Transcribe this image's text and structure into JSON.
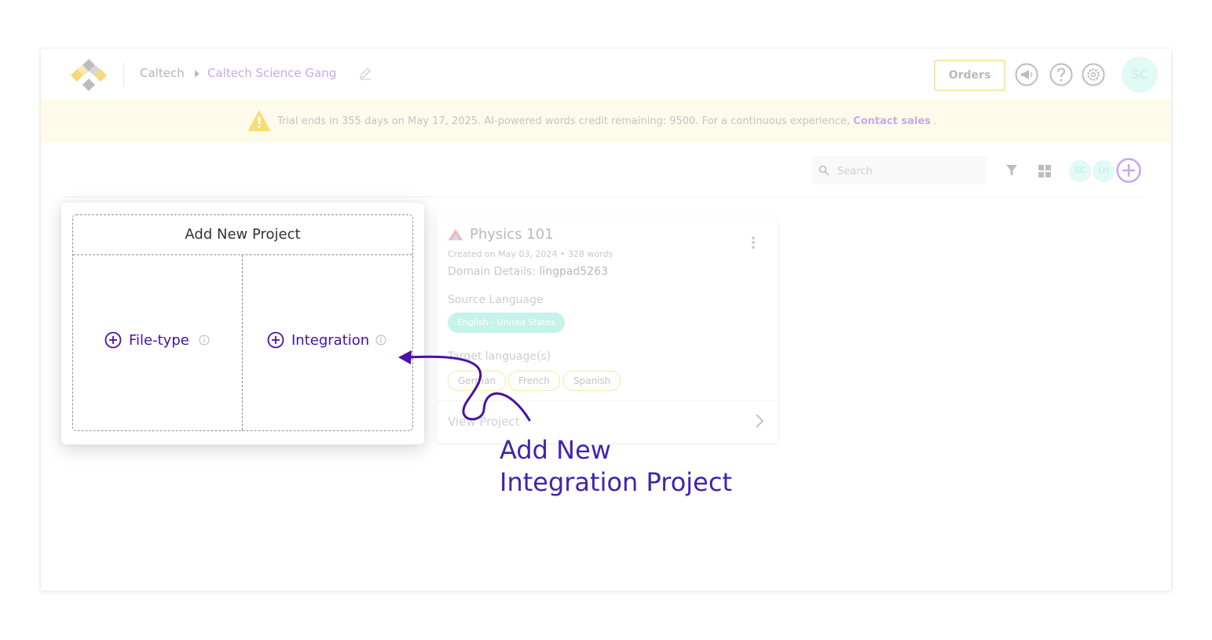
{
  "header": {
    "org": "Caltech",
    "team": "Caltech Science Gang",
    "orders_label": "Orders",
    "avatar_initials": "SC"
  },
  "banner": {
    "text": "Trial ends in 355 days on May 17, 2025. AI-powered words credit remaining: 9500. For a continuous experience, ",
    "link": "Contact sales",
    "suffix": " ."
  },
  "toolbar": {
    "search_placeholder": "Search",
    "members": [
      "SC",
      "LH"
    ]
  },
  "project": {
    "title": "Physics 101",
    "created": "Created on May 03, 2024",
    "bullet": "•",
    "words": "328 words",
    "domain_label": "Domain Details: ",
    "domain_value": "lingpad5263",
    "source_label": "Source Language",
    "source_language": "English - United States",
    "target_label": "Target language(s)",
    "target_languages": [
      "German",
      "French",
      "Spanish"
    ],
    "view_label": "View Project"
  },
  "popup": {
    "title": "Add New Project",
    "option_filetype": "File-type",
    "option_integration": "Integration"
  },
  "callout": {
    "line1": "Add New",
    "line2": "Integration Project"
  },
  "colors": {
    "accent_purple": "#4b10a6",
    "callout_purple": "#4323ac",
    "banner_bg": "#fffbea",
    "link_lavender": "#c9a8ec",
    "teal_chip": "#c4f3ea"
  }
}
